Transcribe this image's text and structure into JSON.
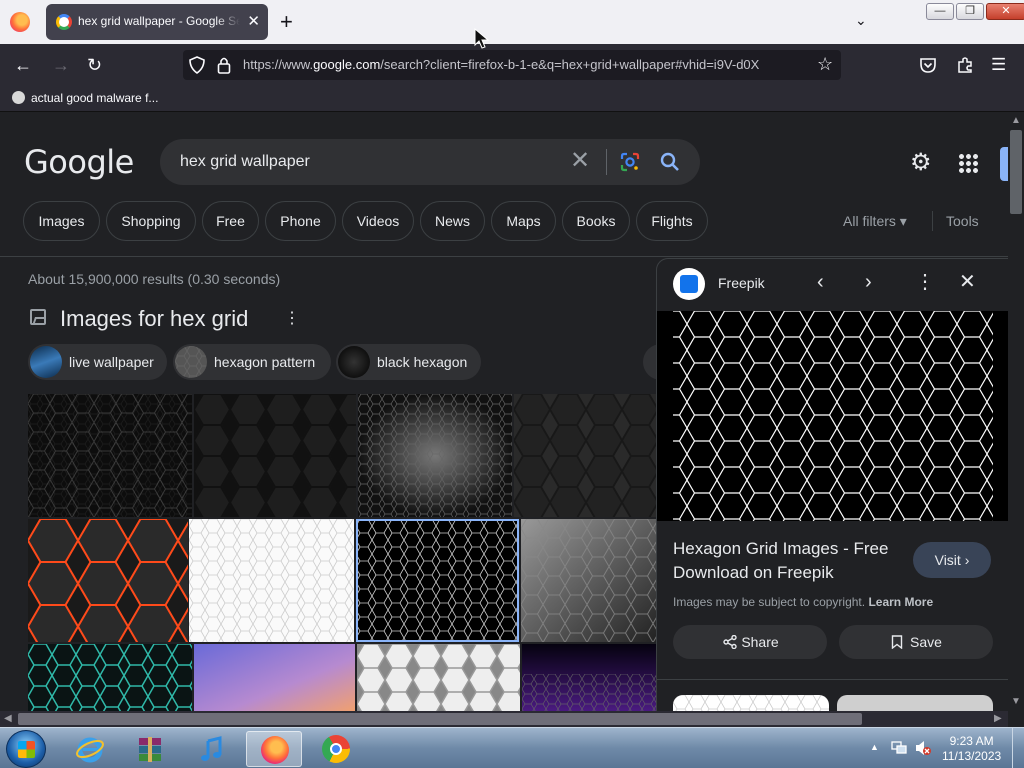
{
  "browser": {
    "tab_title": "hex grid wallpaper - Google Search",
    "url_prefix": "https://www.",
    "url_domain": "google.com",
    "url_rest": "/search?client=firefox-b-1-e&q=hex+grid+wallpaper#vhid=i9V-d0X",
    "bookmark": "actual good malware f..."
  },
  "google": {
    "logo": "Google",
    "query": "hex grid wallpaper",
    "chips": [
      "Images",
      "Shopping",
      "Free",
      "Phone",
      "Videos",
      "News",
      "Maps",
      "Books",
      "Flights"
    ],
    "all_filters": "All filters",
    "tools": "Tools",
    "results_stats": "About 15,900,000 results (0.30 seconds)",
    "images_heading": "Images for hex grid",
    "related": [
      "live wallpaper",
      "hexagon pattern",
      "black hexagon"
    ]
  },
  "panel": {
    "source": "Freepik",
    "title": "Hexagon Grid Images - Free Download on Freepik",
    "visit": "Visit",
    "copyright": "Images may be subject to copyright.",
    "learn_more": "Learn More",
    "share": "Share",
    "save": "Save"
  },
  "taskbar": {
    "time": "9:23 AM",
    "date": "11/13/2023"
  },
  "colors": {
    "accent": "#8ab4f8",
    "page_bg": "#202124"
  }
}
